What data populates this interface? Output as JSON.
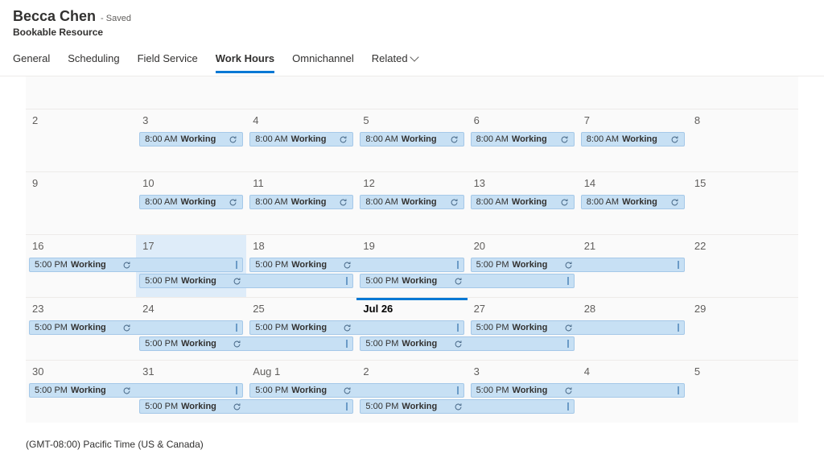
{
  "header": {
    "name": "Becca Chen",
    "saved_label": "- Saved",
    "entity": "Bookable Resource"
  },
  "tabs": [
    {
      "label": "General",
      "key": "general"
    },
    {
      "label": "Scheduling",
      "key": "scheduling"
    },
    {
      "label": "Field Service",
      "key": "field-service"
    },
    {
      "label": "Work Hours",
      "key": "work-hours",
      "active": true
    },
    {
      "label": "Omnichannel",
      "key": "omnichannel"
    },
    {
      "label": "Related",
      "key": "related",
      "dropdown": true
    }
  ],
  "labels": {
    "working": "Working"
  },
  "times": {
    "t8": "8:00 AM",
    "t5": "5:00 PM"
  },
  "days": {
    "w1": [
      "2",
      "3",
      "4",
      "5",
      "6",
      "7",
      "8"
    ],
    "w2": [
      "9",
      "10",
      "11",
      "12",
      "13",
      "14",
      "15"
    ],
    "w3": [
      "16",
      "17",
      "18",
      "19",
      "20",
      "21",
      "22"
    ],
    "w4": [
      "23",
      "24",
      "25",
      "Jul 26",
      "27",
      "28",
      "29"
    ],
    "w5": [
      "30",
      "31",
      "Aug 1",
      "2",
      "3",
      "4",
      "5"
    ]
  },
  "footer": "(GMT-08:00) Pacific Time (US & Canada)"
}
